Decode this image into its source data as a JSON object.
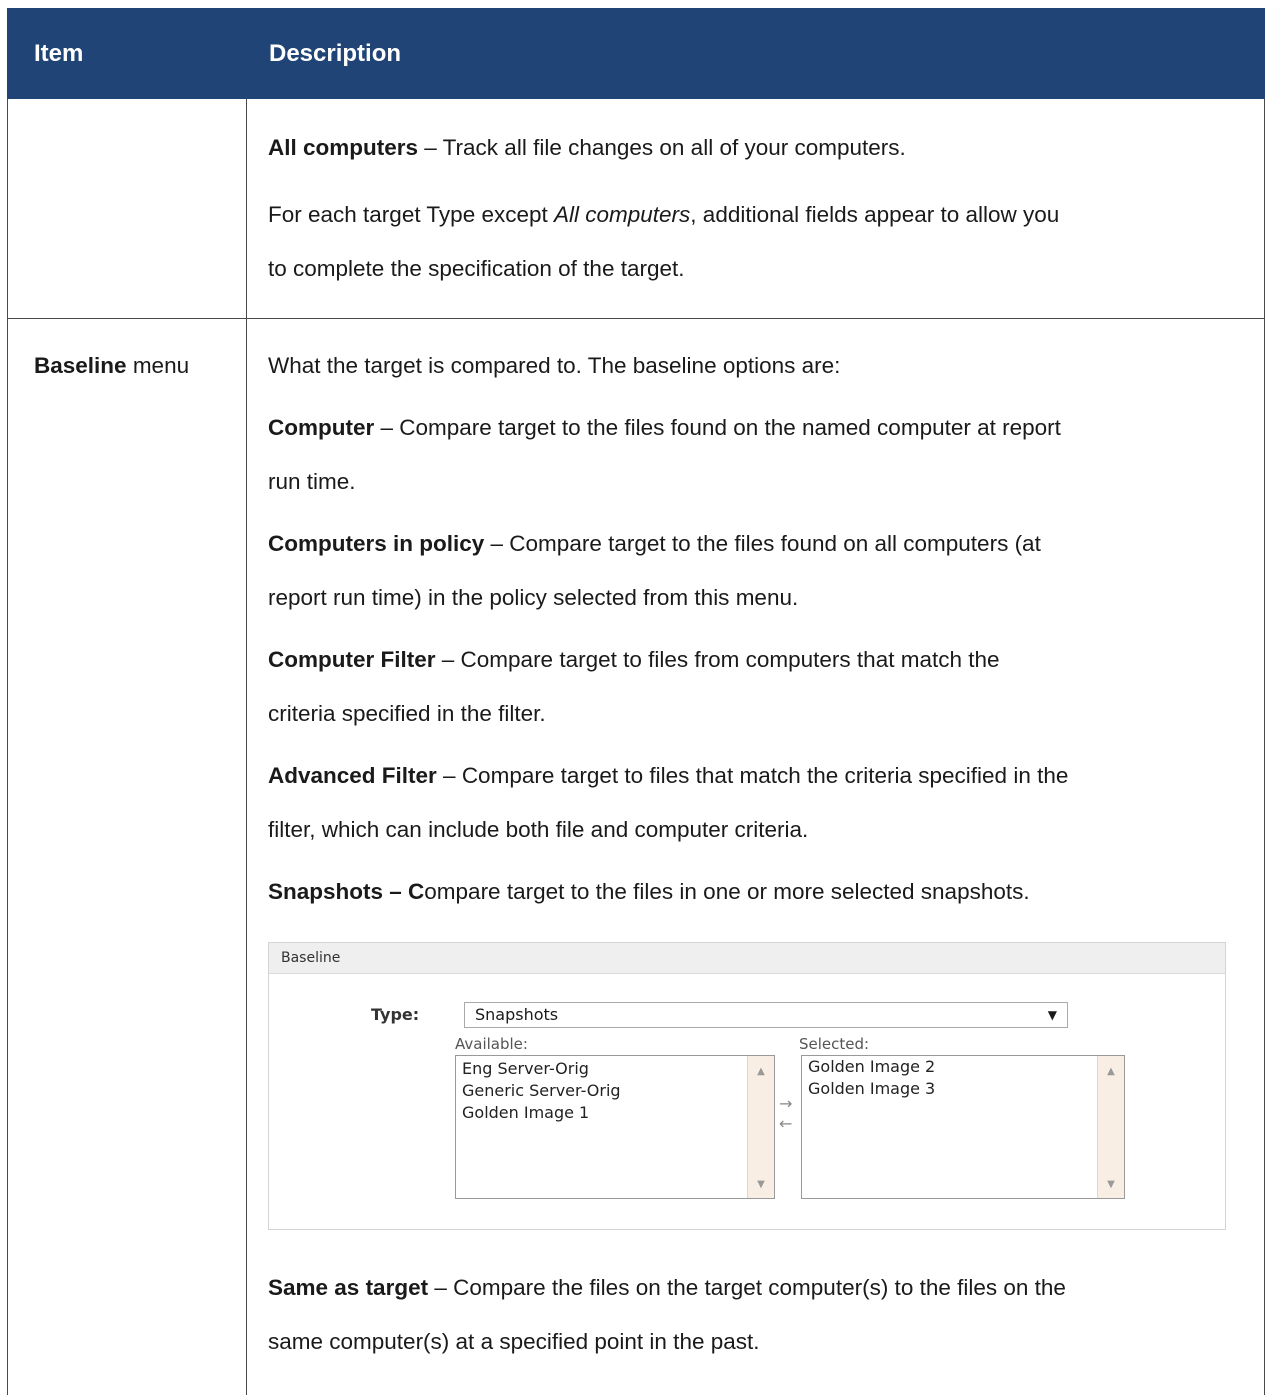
{
  "header": {
    "item": "Item",
    "description": "Description"
  },
  "row1": {
    "p1_bold": "All computers",
    "p1_rest": " – Track all file changes on all of your computers.",
    "p2_a": "For each target Type except ",
    "p2_italic": "All computers",
    "p2_b": ", additional fields appear to allow you",
    "p2_line2": "to complete the specification of the target."
  },
  "row2": {
    "item_bold": "Baseline",
    "item_rest": " menu",
    "intro": "What the target is compared to. The baseline options are:",
    "computer_bold": "Computer",
    "computer_l1": " – Compare target to the files found on the named computer at report",
    "computer_l2": "run time.",
    "policy_bold": "Computers in policy",
    "policy_l1": " – Compare target to the files found on all computers (at",
    "policy_l2": "report run time) in the policy selected from this menu.",
    "filter_bold": "Computer Filter",
    "filter_l1": " – Compare target to files from computers that match the",
    "filter_l2": "criteria specified in the filter.",
    "adv_bold": "Advanced Filter",
    "adv_l1": " – Compare target to files that match the criteria specified in the",
    "adv_l2": "filter, which can include both file and computer criteria.",
    "snap_bold": "Snapshots – C",
    "snap_rest": "ompare target to the files in one or more selected snapshots.",
    "same_bold": "Same as target",
    "same_l1": " – Compare the files on the target computer(s) to the files on the",
    "same_l2": "same computer(s) at a specified point in the past."
  },
  "baseline_widget": {
    "title": "Baseline",
    "type_label": "Type:",
    "type_value": "Snapshots",
    "available_label": "Available:",
    "selected_label": "Selected:",
    "available_items": [
      "Eng Server-Orig",
      "Generic Server-Orig",
      "Golden Image 1"
    ],
    "selected_items": [
      "Golden Image 2",
      "Golden Image 3"
    ],
    "move_right": "→",
    "move_left": "←",
    "dropdown_arrow": "▼",
    "scroll_up": "▲",
    "scroll_down": "▼"
  }
}
